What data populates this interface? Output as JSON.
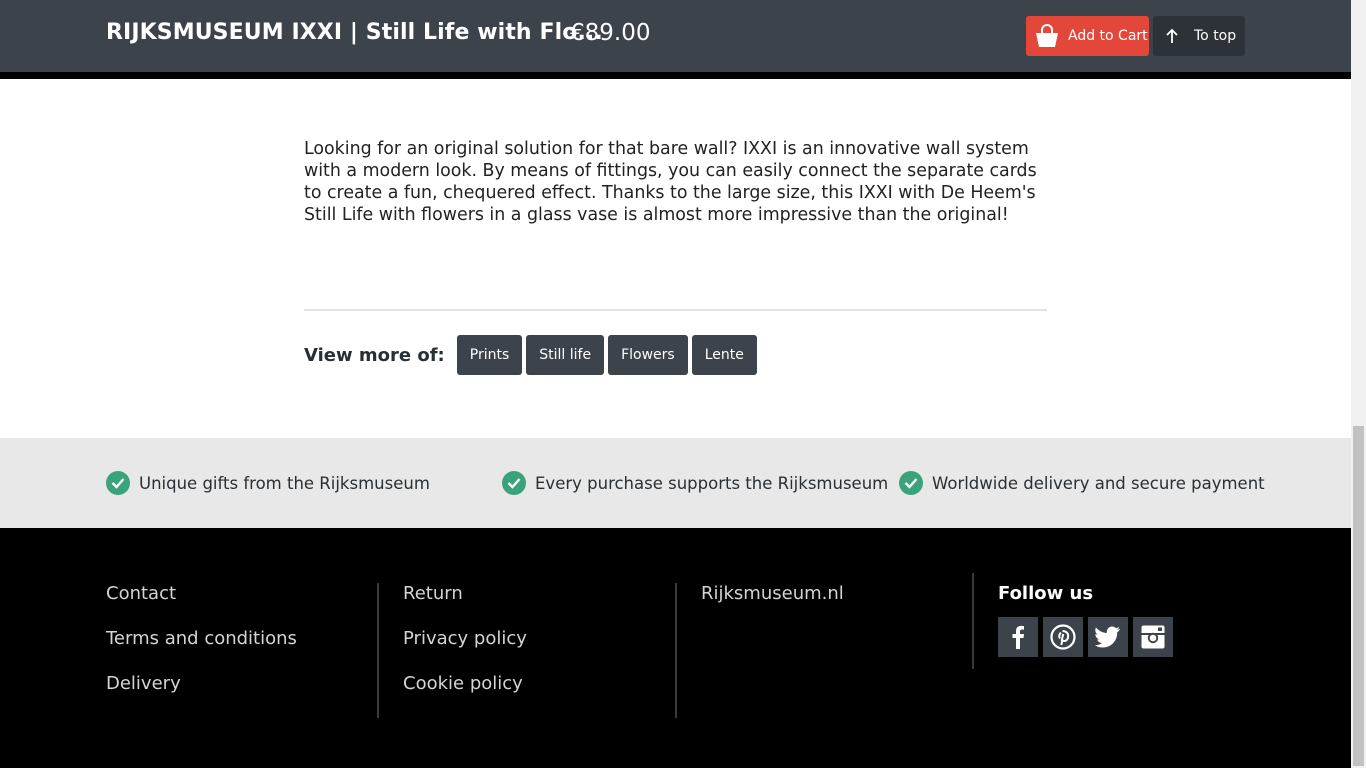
{
  "header": {
    "title": "RIJKSMUSEUM IXXI | Still Life with Flo...",
    "price": "€89.00",
    "add_to_cart": "Add to Cart",
    "to_top": "To top"
  },
  "description": "Looking for an original solution for that bare wall? IXXI is an innovative wall system with a modern look. By means of fittings, you can easily connect the separate cards to create a fun, chequered effect. Thanks to the large size, this IXXI with De Heem's Still Life with flowers in a glass vase is almost more impressive than the original!",
  "view_more": {
    "label": "View more of:",
    "tags": [
      "Prints",
      "Still life",
      "Flowers",
      "Lente"
    ]
  },
  "usps": [
    "Unique gifts from the Rijksmuseum",
    "Every purchase supports the Rijksmuseum",
    "Worldwide delivery and secure payment"
  ],
  "footer": {
    "col1": [
      "Contact",
      "Terms and conditions",
      "Delivery"
    ],
    "col2": [
      "Return",
      "Privacy policy",
      "Cookie policy"
    ],
    "col3": [
      "Rijksmuseum.nl"
    ],
    "follow_us": "Follow us",
    "social": [
      "facebook-icon",
      "pinterest-icon",
      "twitter-icon",
      "instagram-icon"
    ]
  },
  "colors": {
    "header_bg": "#3c434a",
    "cart_red": "#e2473a",
    "check_green": "#3aa37c",
    "usp_bg": "#e8e8e8",
    "footer_bg": "#000000"
  }
}
